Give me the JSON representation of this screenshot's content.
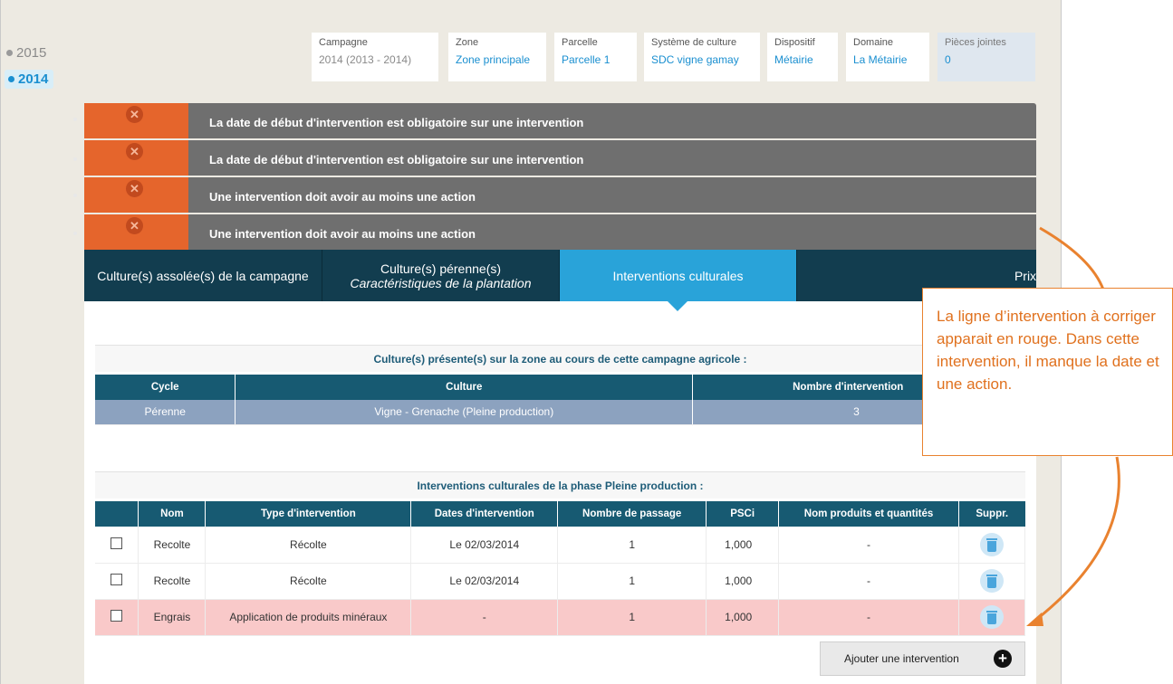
{
  "years": [
    {
      "label": "2015"
    },
    {
      "label": "2014"
    }
  ],
  "info": [
    {
      "label": "Campagne",
      "value": "2014 (2013 - 2014)"
    },
    {
      "label": "Zone",
      "value": "Zone principale"
    },
    {
      "label": "Parcelle",
      "value": "Parcelle 1"
    },
    {
      "label": "Système de culture",
      "value": "SDC vigne gamay"
    },
    {
      "label": "Dispositif",
      "value": "Métairie"
    },
    {
      "label": "Domaine",
      "value": "La Métairie"
    },
    {
      "label": "Pièces jointes",
      "value": "0"
    }
  ],
  "errors": [
    "La date de début d'intervention est obligatoire sur une intervention",
    "La date de début d'intervention est obligatoire sur une intervention",
    "Une intervention doit avoir au moins une action",
    "Une intervention doit avoir au moins une action"
  ],
  "tabs": [
    {
      "label": "Culture(s) assolée(s) de la campagne",
      "sub": ""
    },
    {
      "label": "Culture(s) pérenne(s)",
      "sub": "Caractéristiques de la plantation"
    },
    {
      "label": "Interventions culturales",
      "sub": ""
    },
    {
      "label": "Prix",
      "sub": ""
    }
  ],
  "crops": {
    "title": "Culture(s) présente(s) sur la zone au cours de cette campagne agricole :",
    "headers": [
      "Cycle",
      "Culture",
      "Nombre d'intervention"
    ],
    "rows": [
      [
        "Pérenne",
        "Vigne - Grenache (Pleine production)",
        "3"
      ]
    ]
  },
  "interventions": {
    "title": "Interventions culturales de la phase Pleine production :",
    "headers": [
      "",
      "Nom",
      "Type d'intervention",
      "Dates d'intervention",
      "Nombre de passage",
      "PSCi",
      "Nom produits et quantités",
      "Suppr."
    ],
    "rows": [
      {
        "name": "Recolte",
        "type": "Récolte",
        "dates": "Le 02/03/2014",
        "passages": "1",
        "psci": "1,000",
        "products": "-"
      },
      {
        "name": "Recolte",
        "type": "Récolte",
        "dates": "Le 02/03/2014",
        "passages": "1",
        "psci": "1,000",
        "products": "-"
      },
      {
        "name": "Engrais",
        "type": "Application de produits minéraux",
        "dates": "-",
        "passages": "1",
        "psci": "1,000",
        "products": "-"
      }
    ],
    "add_label": "Ajouter une intervention"
  },
  "annotation": {
    "text": "La ligne d’intervention à corriger apparait en rouge. Dans cette intervention, il manque la date et une action.",
    "color": "#e9822f"
  },
  "colors": {
    "error_icon": "#e5652c",
    "error_bar": "#6f6f6f",
    "tab_dark": "#123d4f",
    "tab_active": "#29a3d9",
    "table_header": "#175a72",
    "error_row": "#f9c9c9"
  },
  "icons": {
    "error": "x-circle-icon",
    "delete": "trash-icon",
    "add": "plus-circle-icon"
  }
}
